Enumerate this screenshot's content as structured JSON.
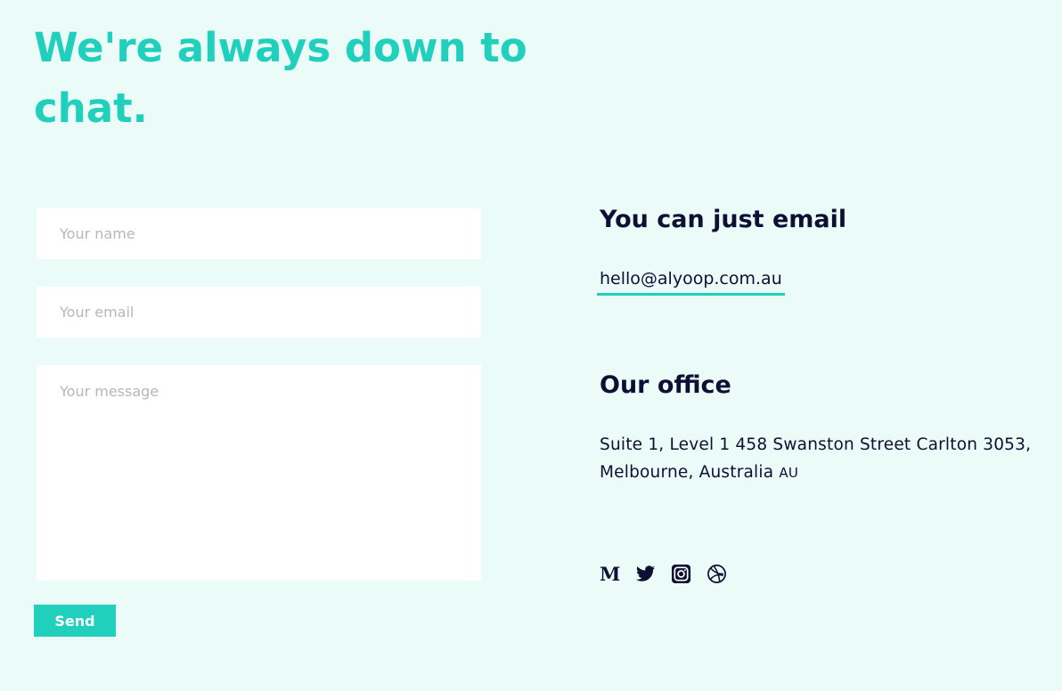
{
  "hero": {
    "title": "We're always down to chat."
  },
  "form": {
    "name_placeholder": "Your name",
    "email_placeholder": "Your email",
    "message_placeholder": "Your message",
    "send_label": "Send"
  },
  "contact": {
    "email_heading": "You can just email",
    "email_address": "hello@alyoop.com.au",
    "office_heading": "Our office",
    "address_line_1": "Suite 1, Level 1 458 Swanston Street Carlton 3053,",
    "address_line_2": "Melbourne, Australia",
    "country_code": "AU"
  },
  "socials": [
    {
      "icon": "medium-icon"
    },
    {
      "icon": "twitter-icon"
    },
    {
      "icon": "instagram-icon"
    },
    {
      "icon": "dribbble-icon"
    }
  ],
  "colors": {
    "background": "#eafbf8",
    "accent": "#20cfbc",
    "text": "#0d1033",
    "field": "#ffffff",
    "placeholder": "#b3b7c0"
  }
}
